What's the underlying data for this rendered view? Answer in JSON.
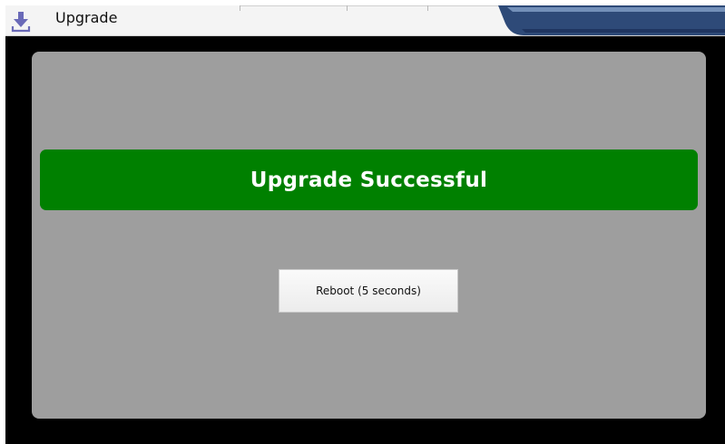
{
  "header": {
    "title": "Upgrade",
    "icon": "download-icon",
    "icon_color": "#6a6ab8",
    "accent_color": "#2e4a78"
  },
  "dialog": {
    "status_text": "Upgrade Successful",
    "status_color": "#008000",
    "panel_color": "#9e9e9e",
    "reboot_label": "Reboot (5 seconds)"
  }
}
